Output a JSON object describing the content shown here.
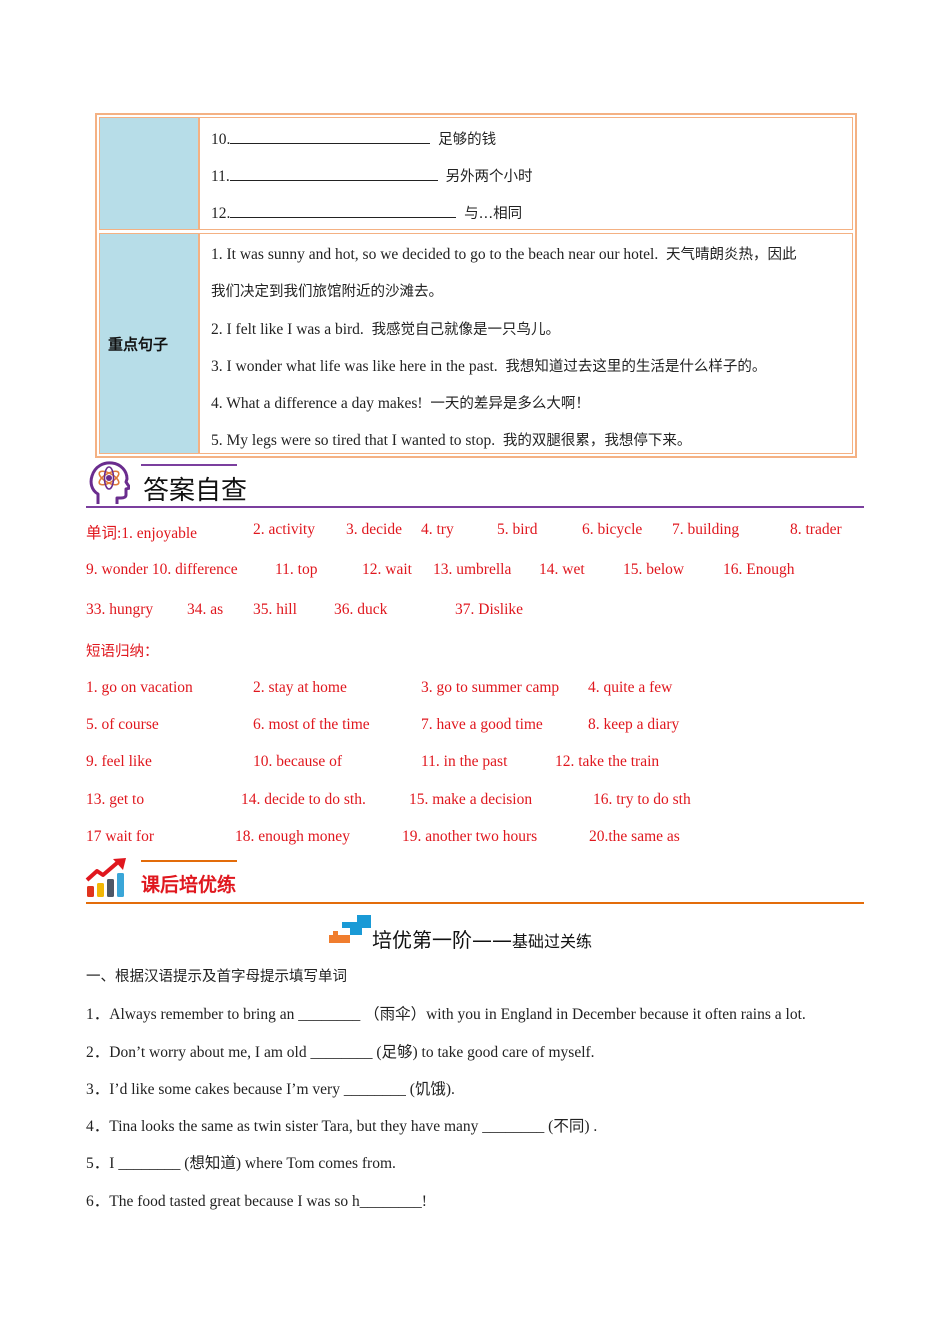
{
  "phrase_table": {
    "blank_rows": [
      {
        "num": "10.",
        "meaning": "足够的钱"
      },
      {
        "num": "11.",
        "meaning": "另外两个小时"
      },
      {
        "num": "12.",
        "meaning": "与…相同"
      }
    ],
    "sentences_label": "重点句子",
    "sentences": [
      {
        "en": "1. It was sunny and hot, so we decided to go to the beach near our hotel.",
        "cn": "天气晴朗炎热，因此"
      },
      {
        "en": "",
        "cn": "我们决定到我们旅馆附近的沙滩去。"
      },
      {
        "en": "2. I felt like I was a bird.",
        "cn": "我感觉自己就像是一只鸟儿。"
      },
      {
        "en": "3. I wonder what life was like here in the past.",
        "cn": "我想知道过去这里的生活是什么样子的。"
      },
      {
        "en": "4. What a difference a day makes!",
        "cn": "一天的差异是多么大啊！"
      },
      {
        "en": "5. My legs were so tired that I wanted to stop.",
        "cn": "我的双腿很累，我想停下来。"
      }
    ]
  },
  "answers_section": {
    "title": "答案自查",
    "icon": "head-atom-icon",
    "accent_color": "#7b3f9e",
    "words_rows": [
      [
        "单词:1. enjoyable",
        "2. activity",
        "3. decide",
        "4. try",
        "5. bird",
        "6. bicycle",
        "7. building",
        "8. trader"
      ],
      [
        "9. wonder 10. difference",
        "11. top",
        "12. wait",
        "13. umbrella",
        "14. wet",
        "15. below",
        "16. Enough"
      ],
      [
        "33. hungry",
        "34. as",
        "35. hill",
        "36. duck",
        "37. Dislike"
      ]
    ],
    "phrases_label": "短语归纳：",
    "phrase_rows": [
      [
        "1. go on vacation",
        "2. stay at home",
        "3. go to summer camp",
        "4. quite a few"
      ],
      [
        "5. of course",
        "6. most of the time",
        "7. have a good time",
        "8. keep a diary"
      ],
      [
        "9. feel like",
        "10. because of",
        "11. in the past",
        "12. take the train"
      ],
      [
        "13. get to",
        "14. decide to do sth.",
        "15. make a decision",
        "16. try to do sth"
      ],
      [
        "17 wait for",
        "18. enough money",
        "19. another two hours",
        "20.the same as"
      ]
    ],
    "answer_color": "#e0171e"
  },
  "practice_section": {
    "title": "课后培优练",
    "icon": "growth-chart-icon",
    "accent_color": "#e36c0a",
    "level_title_main": "培优第一阶——",
    "level_title_sub": "基础过关练",
    "level_icon": "steps-icon",
    "instruction": "一、根据汉语提示及首字母提示填写单词",
    "questions": [
      {
        "num": "1．",
        "before": "Always remember to bring an ",
        "blank": "________",
        "after": " （雨伞）with you in England in December because it often rains a lot."
      },
      {
        "num": "2．",
        "before": "Don’t worry about me, I am old ",
        "blank": "________",
        "after": " (足够) to take good care of myself."
      },
      {
        "num": "3．",
        "before": "I’d like some cakes because I’m very ",
        "blank": "________",
        "after": " (饥饿)."
      },
      {
        "num": "4．",
        "before": "Tina looks the same as twin sister Tara, but they have many ",
        "blank": "________",
        "after": " (不同) ."
      },
      {
        "num": "5．",
        "before": "I ",
        "blank": "________",
        "after": " (想知道) where Tom comes from."
      },
      {
        "num": "6．",
        "before": "The food tasted great because I was so h",
        "blank": "________",
        "after": "!"
      }
    ]
  }
}
